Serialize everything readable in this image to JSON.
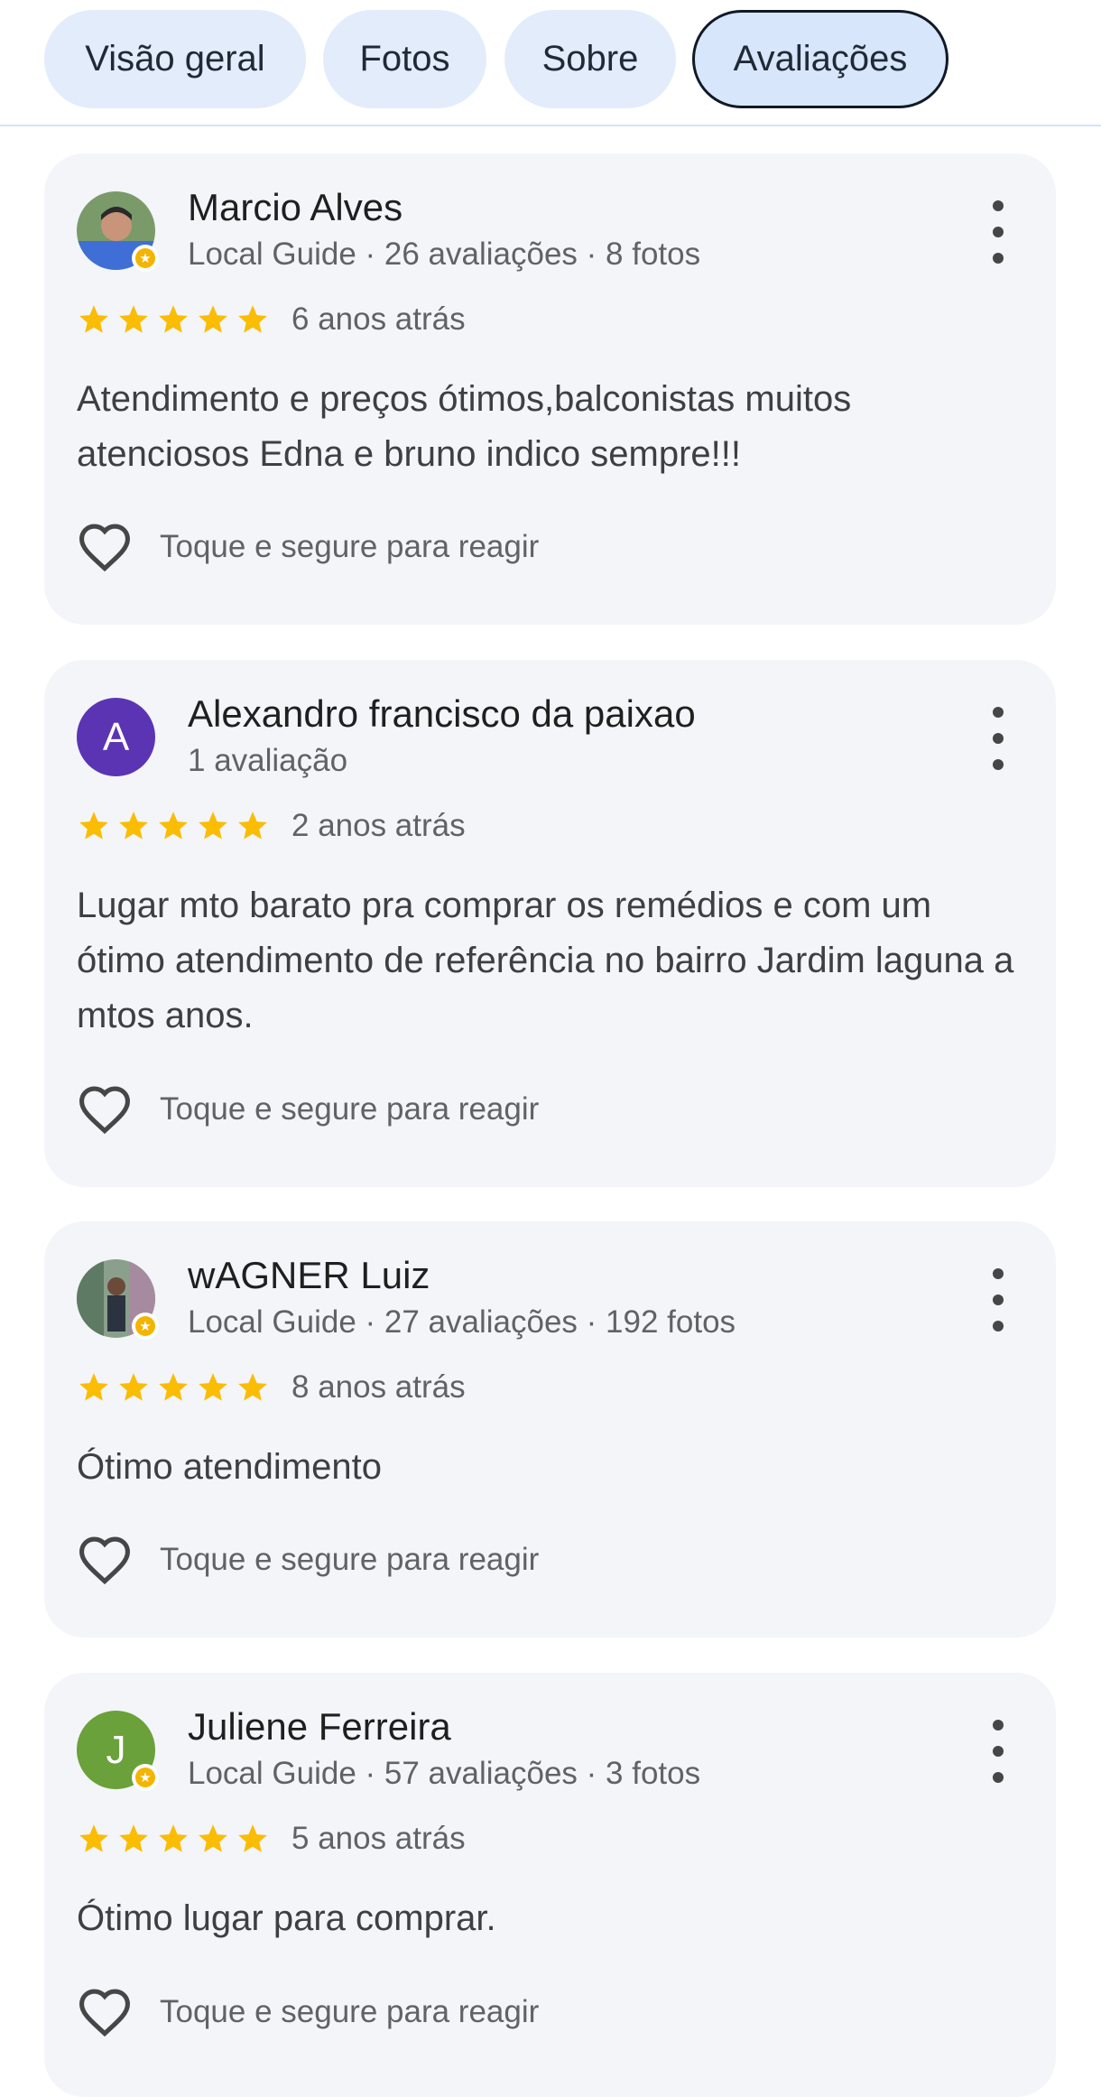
{
  "tabs": [
    {
      "label": "Visão geral"
    },
    {
      "label": "Fotos"
    },
    {
      "label": "Sobre"
    },
    {
      "label": "Avaliações",
      "active": true
    }
  ],
  "reviews": [
    {
      "name": "Marcio Alves",
      "meta": "Local Guide · 26 avaliações · 8 fotos",
      "local_guide": true,
      "rating": 5,
      "when": "6 anos atrás",
      "text": "Atendimento e preços ótimos,balconistas muitos atenciosos Edna e bruno indico sempre!!!",
      "react_label": "Toque e segure para reagir"
    },
    {
      "name": "Alexandro francisco da paixao",
      "meta": "1 avaliação",
      "avatar_letter": "A",
      "avatar_color": "#5b34b3",
      "local_guide": false,
      "rating": 5,
      "when": "2 anos atrás",
      "text": "Lugar mto barato pra comprar os remédios e com um ótimo atendimento de referência no bairro Jardim laguna a mtos anos.",
      "react_label": "Toque e segure para reagir"
    },
    {
      "name": "wAGNER Luiz",
      "meta": "Local Guide · 27 avaliações · 192 fotos",
      "local_guide": true,
      "rating": 5,
      "when": "8 anos atrás",
      "text": "Ótimo atendimento",
      "react_label": "Toque e segure para reagir"
    },
    {
      "name": "Juliene Ferreira",
      "meta": "Local Guide · 57 avaliações · 3 fotos",
      "avatar_letter": "J",
      "avatar_color": "#6aa13a",
      "local_guide": true,
      "rating": 5,
      "when": "5 anos atrás",
      "text": "Ótimo lugar para comprar.",
      "react_label": "Toque e segure para reagir"
    }
  ],
  "colors": {
    "star": "#fbbc04",
    "tab_bg": "#e3ecfb",
    "card_bg": "#f3f5f8"
  },
  "icons": [
    "star-icon",
    "heart-icon",
    "more-vert-icon",
    "local-guide-badge-icon"
  ]
}
